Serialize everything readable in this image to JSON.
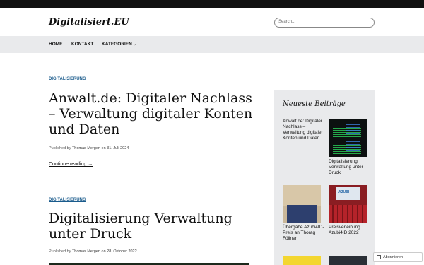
{
  "site": {
    "title": "Digitalisiert.EU"
  },
  "search": {
    "placeholder": "Search..."
  },
  "nav": {
    "home": "HOME",
    "kontakt": "KONTAKT",
    "kategorien": "KATEGORIEN"
  },
  "posts": [
    {
      "category": "DIGITALISIERUNG",
      "title": "Anwalt.de: Digitaler Nachlass – Verwaltung digitaler Konten und Daten",
      "meta_prefix": "Published by",
      "author": "Thomas Mergen",
      "meta_on": "on",
      "date": "31. Juli 2024",
      "continue": "Continue reading →"
    },
    {
      "category": "DIGITALISIERUNG",
      "title": "Digitalisierung Verwaltung unter Druck",
      "meta_prefix": "Published by",
      "author": "Thomas Mergen",
      "meta_on": "on",
      "date": "28. Oktober 2022"
    }
  ],
  "sidebar": {
    "title": "Neueste Beiträge",
    "items": [
      {
        "title": "Anwalt.de: Digitaler Nachlass – Verwaltung digitaler Konten und Daten"
      },
      {
        "title": "Digitalisierung Verwaltung unter Druck"
      },
      {
        "title": "Übergabe Azubi4ID-Preis an Thorag Föllner"
      },
      {
        "title": "Preisverleihung Azubi4ID 2022"
      }
    ],
    "thumb3_text": "AZUBI"
  },
  "follow": {
    "label": "Abonnieren"
  }
}
